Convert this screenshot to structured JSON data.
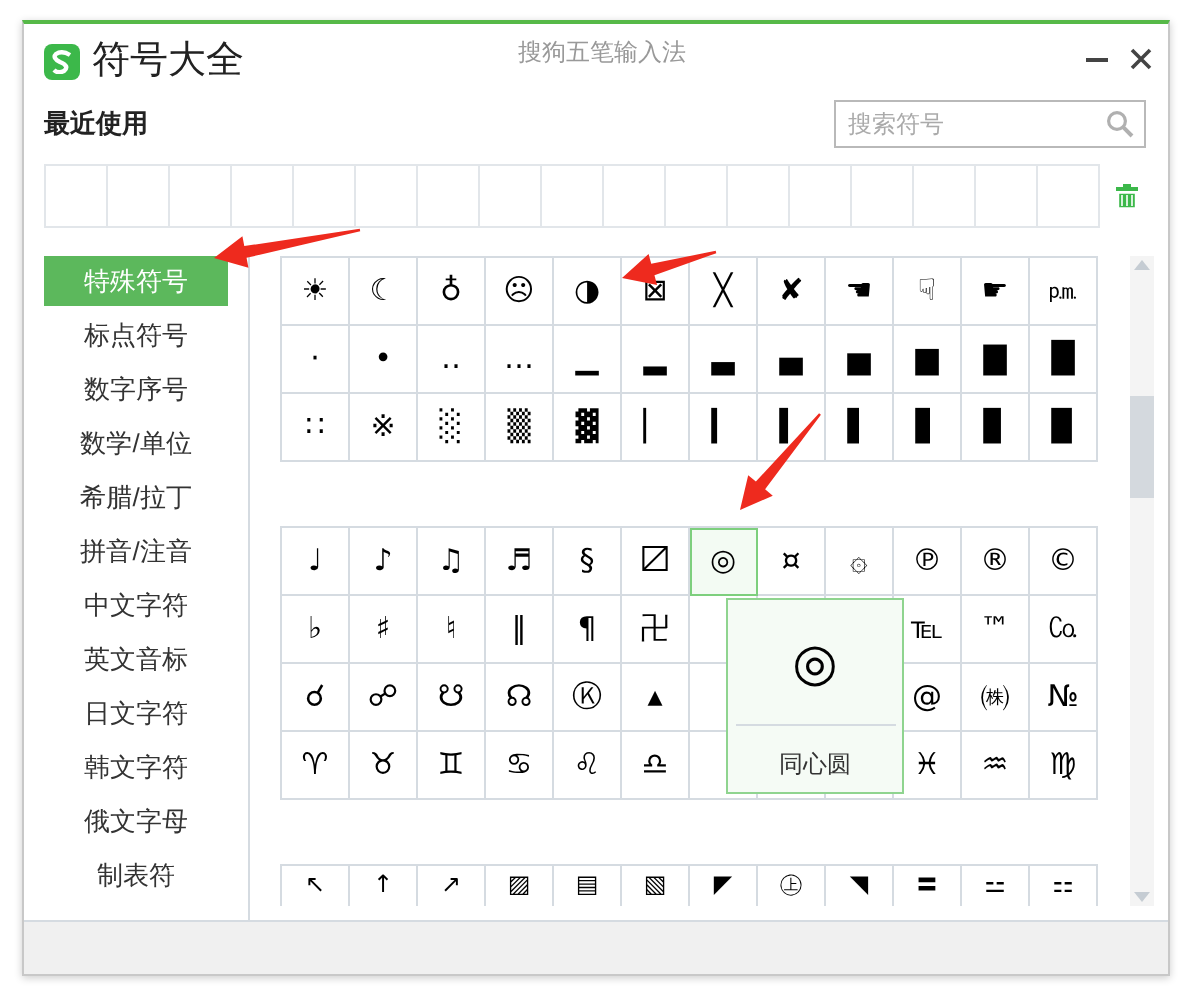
{
  "window": {
    "title": "符号大全",
    "subtitle": "搜狗五笔输入法"
  },
  "recent": {
    "label": "最近使用"
  },
  "search": {
    "placeholder": "搜索符号"
  },
  "sidebar": {
    "items": [
      {
        "label": "特殊符号",
        "selected": true
      },
      {
        "label": "标点符号",
        "selected": false
      },
      {
        "label": "数字序号",
        "selected": false
      },
      {
        "label": "数学/单位",
        "selected": false
      },
      {
        "label": "希腊/拉丁",
        "selected": false
      },
      {
        "label": "拼音/注音",
        "selected": false
      },
      {
        "label": "中文字符",
        "selected": false
      },
      {
        "label": "英文音标",
        "selected": false
      },
      {
        "label": "日文字符",
        "selected": false
      },
      {
        "label": "韩文字符",
        "selected": false
      },
      {
        "label": "俄文字母",
        "selected": false
      },
      {
        "label": "制表符",
        "selected": false
      }
    ]
  },
  "groups": [
    {
      "rows": [
        [
          {
            "symbol": "☀",
            "selected": false
          },
          {
            "symbol": "☾",
            "selected": false
          },
          {
            "symbol": "♁",
            "selected": false
          },
          {
            "symbol": "☹",
            "selected": false
          },
          {
            "symbol": "◑",
            "selected": false
          },
          {
            "symbol": "⊠",
            "selected": false
          },
          {
            "symbol": "╳",
            "selected": false
          },
          {
            "symbol": "✘",
            "selected": false
          },
          {
            "symbol": "☚",
            "selected": false
          },
          {
            "symbol": "☟",
            "selected": false
          },
          {
            "symbol": "☛",
            "selected": false
          },
          {
            "symbol": "㏘",
            "selected": false
          }
        ],
        [
          {
            "symbol": "·",
            "selected": false
          },
          {
            "symbol": "•",
            "selected": false
          },
          {
            "symbol": "‥",
            "selected": false
          },
          {
            "symbol": "…",
            "selected": false
          },
          {
            "symbol": "▁",
            "selected": false
          },
          {
            "symbol": "▂",
            "selected": false
          },
          {
            "symbol": "▃",
            "selected": false
          },
          {
            "symbol": "▄",
            "selected": false
          },
          {
            "symbol": "▅",
            "selected": false
          },
          {
            "symbol": "▆",
            "selected": false
          },
          {
            "symbol": "▇",
            "selected": false
          },
          {
            "symbol": "█",
            "selected": false
          }
        ],
        [
          {
            "symbol": "∷",
            "selected": false
          },
          {
            "symbol": "※",
            "selected": false
          },
          {
            "symbol": "░",
            "selected": false
          },
          {
            "symbol": "▒",
            "selected": false
          },
          {
            "symbol": "▓",
            "selected": false
          },
          {
            "symbol": "▏",
            "selected": false
          },
          {
            "symbol": "▎",
            "selected": false
          },
          {
            "symbol": "▍",
            "selected": false
          },
          {
            "symbol": "▌",
            "selected": false
          },
          {
            "symbol": "▋",
            "selected": false
          },
          {
            "symbol": "▊",
            "selected": false
          },
          {
            "symbol": "▉",
            "selected": false
          }
        ]
      ]
    },
    {
      "rows": [
        [
          {
            "symbol": "♩",
            "selected": false
          },
          {
            "symbol": "♪",
            "selected": false
          },
          {
            "symbol": "♫",
            "selected": false
          },
          {
            "symbol": "♬",
            "selected": false
          },
          {
            "symbol": "§",
            "selected": false
          },
          {
            "symbol": "〼",
            "selected": false
          },
          {
            "symbol": "◎",
            "selected": true
          },
          {
            "symbol": "¤",
            "selected": false
          },
          {
            "symbol": "۞",
            "selected": false
          },
          {
            "symbol": "℗",
            "selected": false
          },
          {
            "symbol": "®",
            "selected": false
          },
          {
            "symbol": "©",
            "selected": false
          }
        ],
        [
          {
            "symbol": "♭",
            "selected": false
          },
          {
            "symbol": "♯",
            "selected": false
          },
          {
            "symbol": "♮",
            "selected": false
          },
          {
            "symbol": "‖",
            "selected": false
          },
          {
            "symbol": "¶",
            "selected": false
          },
          {
            "symbol": "卍",
            "selected": false
          },
          null,
          null,
          null,
          {
            "symbol": "℡",
            "selected": false
          },
          {
            "symbol": "™",
            "selected": false
          },
          {
            "symbol": "㏇",
            "selected": false
          }
        ],
        [
          {
            "symbol": "☌",
            "selected": false
          },
          {
            "symbol": "☍",
            "selected": false
          },
          {
            "symbol": "☋",
            "selected": false
          },
          {
            "symbol": "☊",
            "selected": false
          },
          {
            "symbol": "Ⓚ",
            "selected": false
          },
          {
            "symbol": "▴",
            "selected": false
          },
          null,
          null,
          null,
          {
            "symbol": "@",
            "selected": false
          },
          {
            "symbol": "㈱",
            "selected": false
          },
          {
            "symbol": "№",
            "selected": false
          }
        ],
        [
          {
            "symbol": "♈",
            "selected": false
          },
          {
            "symbol": "♉",
            "selected": false
          },
          {
            "symbol": "♊",
            "selected": false
          },
          {
            "symbol": "♋",
            "selected": false
          },
          {
            "symbol": "♌",
            "selected": false
          },
          {
            "symbol": "♎",
            "selected": false
          },
          null,
          null,
          null,
          {
            "symbol": "♓",
            "selected": false
          },
          {
            "symbol": "♒",
            "selected": false
          },
          {
            "symbol": "♍",
            "selected": false
          }
        ]
      ],
      "popup": {
        "symbol": "◎",
        "name": "同心圆"
      }
    },
    {
      "rows": [
        [
          {
            "symbol": "↖",
            "selected": false
          },
          {
            "symbol": "↑",
            "selected": false
          },
          {
            "symbol": "↗",
            "selected": false
          },
          {
            "symbol": "▨",
            "selected": false
          },
          {
            "symbol": "▤",
            "selected": false
          },
          {
            "symbol": "▧",
            "selected": false
          },
          {
            "symbol": "◤",
            "selected": false
          },
          {
            "symbol": "㊤",
            "selected": false
          },
          {
            "symbol": "◥",
            "selected": false
          },
          {
            "symbol": "〓",
            "selected": false
          },
          {
            "symbol": "⚍",
            "selected": false
          },
          {
            "symbol": "⚏",
            "selected": false
          }
        ]
      ]
    }
  ]
}
